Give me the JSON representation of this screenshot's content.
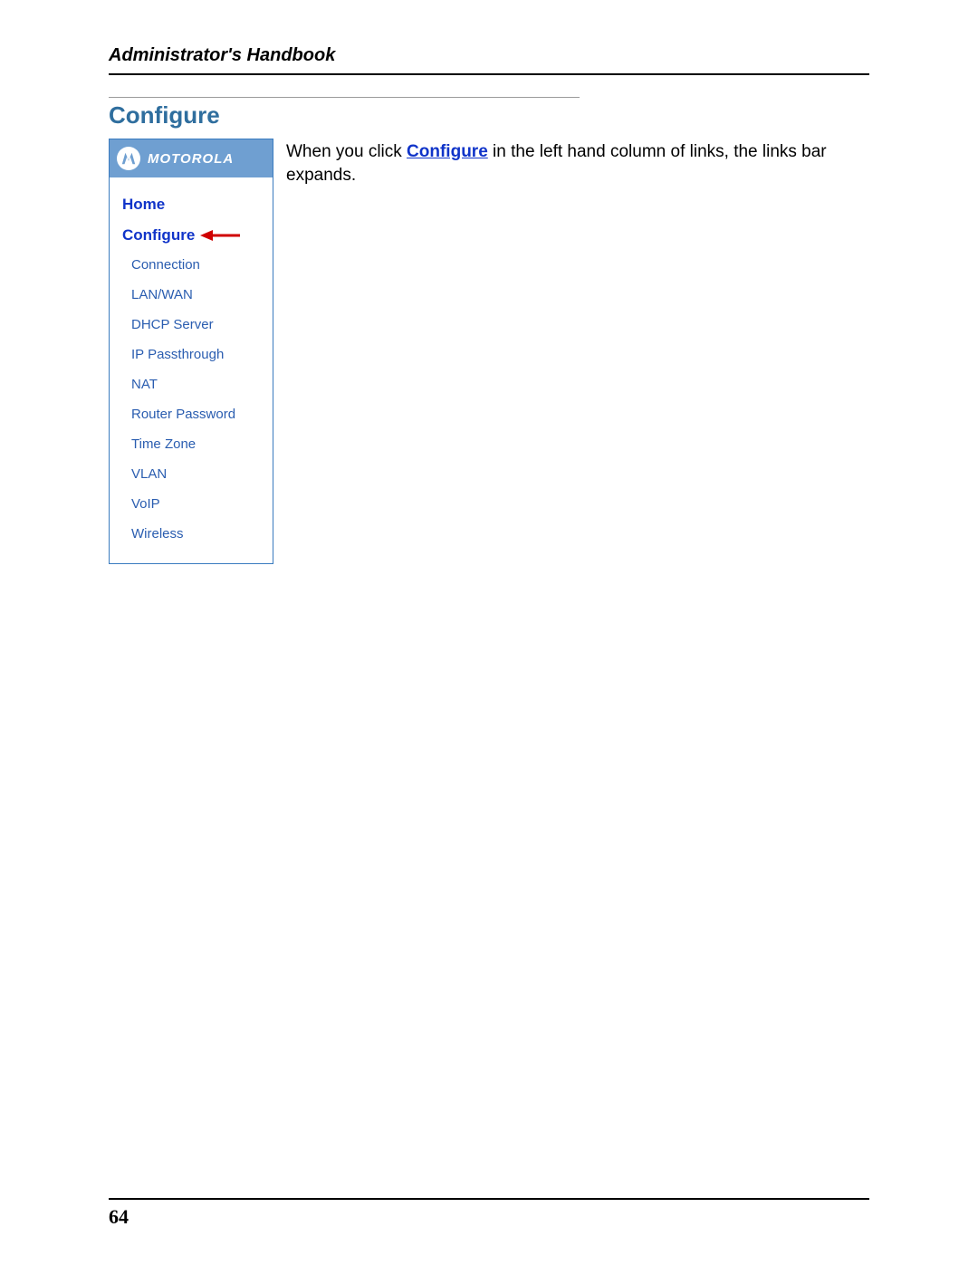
{
  "running_head": "Administrator's Handbook",
  "section_title": "Configure",
  "body": {
    "pre": "When you click ",
    "keyword": "Configure",
    "post": " in the left hand column of links, the links bar expands."
  },
  "sidebar": {
    "brand": "MOTOROLA",
    "top_links": {
      "home": "Home",
      "configure": "Configure"
    },
    "sub_links": [
      "Connection",
      "LAN/WAN",
      "DHCP Server",
      "IP Passthrough",
      "NAT",
      "Router Password",
      "Time Zone",
      "VLAN",
      "VoIP",
      "Wireless"
    ]
  },
  "page_number": "64"
}
